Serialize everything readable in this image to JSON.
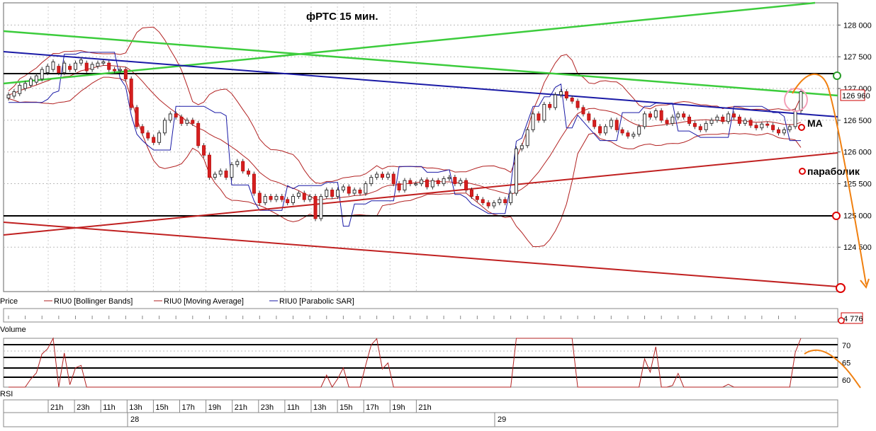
{
  "chart_data": {
    "type": "candlestick",
    "title": "фРТС   15 мин.",
    "price_axis": {
      "ticks": [
        "128 000",
        "127 500",
        "127 000",
        "126 500",
        "126 000",
        "125 500",
        "125 000",
        "124 500"
      ],
      "tick_values": [
        128000,
        127500,
        127000,
        126500,
        126000,
        125500,
        125000,
        124500
      ],
      "ylim": [
        123800,
        128350
      ],
      "current_value_label": "126 960"
    },
    "volume_panel": {
      "label": "Volume",
      "value_label": "4 776"
    },
    "rsi_panel": {
      "label": "RSI",
      "ticks": [
        "70",
        "65",
        "60"
      ],
      "tick_values": [
        70,
        65,
        60
      ],
      "ylim": [
        58,
        72
      ]
    },
    "time_axis": {
      "hour_labels": [
        "21h",
        "23h",
        "11h",
        "13h",
        "15h",
        "17h",
        "19h",
        "21h",
        "23h",
        "11h",
        "13h",
        "15h",
        "17h",
        "19h",
        "21h"
      ],
      "date_labels": [
        "28",
        "29"
      ]
    },
    "legend": [
      "Price",
      "RIU0 [Bollinger Bands]",
      "RIU0 [Moving Average]",
      "RIU0 [Parabolic SAR]"
    ],
    "annotations": [
      "МА",
      "параболик"
    ],
    "candles": [
      [
        126850,
        126900
      ],
      [
        126880,
        126950
      ],
      [
        126920,
        127050
      ],
      [
        127000,
        127080
      ],
      [
        127050,
        127150
      ],
      [
        127100,
        127200
      ],
      [
        127150,
        127300
      ],
      [
        127250,
        127350
      ],
      [
        127300,
        127420
      ],
      [
        127350,
        127250
      ],
      [
        127250,
        127400
      ],
      [
        127350,
        127300
      ],
      [
        127300,
        127400
      ],
      [
        127400,
        127450
      ],
      [
        127400,
        127280
      ],
      [
        127300,
        127380
      ],
      [
        127350,
        127400
      ],
      [
        127400,
        127420
      ],
      [
        127400,
        127300
      ],
      [
        127300,
        127280
      ],
      [
        127290,
        127300
      ],
      [
        127300,
        127150
      ],
      [
        127150,
        126700
      ],
      [
        126700,
        126400
      ],
      [
        126400,
        126300
      ],
      [
        126300,
        126220
      ],
      [
        126230,
        126150
      ],
      [
        126150,
        126300
      ],
      [
        126300,
        126500
      ],
      [
        126500,
        126600
      ],
      [
        126600,
        126550
      ],
      [
        126550,
        126450
      ],
      [
        126450,
        126500
      ],
      [
        126500,
        126450
      ],
      [
        126450,
        126100
      ],
      [
        126100,
        125950
      ],
      [
        125950,
        125600
      ],
      [
        125600,
        125650
      ],
      [
        125650,
        125700
      ],
      [
        125700,
        125600
      ],
      [
        125600,
        125800
      ],
      [
        125800,
        125850
      ],
      [
        125850,
        125700
      ],
      [
        125700,
        125650
      ],
      [
        125650,
        125350
      ],
      [
        125350,
        125200
      ],
      [
        125200,
        125300
      ],
      [
        125300,
        125250
      ],
      [
        125250,
        125300
      ],
      [
        125300,
        125250
      ],
      [
        125250,
        125200
      ],
      [
        125200,
        125300
      ],
      [
        125300,
        125350
      ],
      [
        125350,
        125250
      ],
      [
        125250,
        125300
      ],
      [
        125300,
        124950
      ],
      [
        124950,
        125300
      ],
      [
        125300,
        125400
      ],
      [
        125400,
        125300
      ],
      [
        125300,
        125400
      ],
      [
        125400,
        125450
      ],
      [
        125450,
        125350
      ],
      [
        125350,
        125400
      ],
      [
        125400,
        125350
      ],
      [
        125350,
        125500
      ],
      [
        125500,
        125600
      ],
      [
        125600,
        125650
      ],
      [
        125650,
        125600
      ],
      [
        125600,
        125650
      ],
      [
        125650,
        125500
      ],
      [
        125500,
        125400
      ],
      [
        125400,
        125550
      ],
      [
        125550,
        125500
      ],
      [
        125500,
        125500
      ],
      [
        125500,
        125560
      ],
      [
        125560,
        125450
      ],
      [
        125450,
        125550
      ],
      [
        125550,
        125500
      ],
      [
        125500,
        125580
      ],
      [
        125580,
        125600
      ],
      [
        125600,
        125500
      ],
      [
        125500,
        125550
      ],
      [
        125550,
        125400
      ],
      [
        125400,
        125300
      ],
      [
        125300,
        125250
      ],
      [
        125250,
        125200
      ],
      [
        125200,
        125150
      ],
      [
        125150,
        125200
      ],
      [
        125200,
        125250
      ],
      [
        125250,
        125200
      ],
      [
        125200,
        125350
      ],
      [
        125350,
        126050
      ],
      [
        126050,
        126100
      ],
      [
        126100,
        126350
      ],
      [
        126350,
        126600
      ],
      [
        126600,
        126500
      ],
      [
        126500,
        126750
      ],
      [
        126750,
        126700
      ],
      [
        126700,
        126900
      ],
      [
        126900,
        126950
      ],
      [
        126950,
        126850
      ],
      [
        126850,
        126800
      ],
      [
        126800,
        126700
      ],
      [
        126700,
        126600
      ],
      [
        126600,
        126500
      ],
      [
        126500,
        126400
      ],
      [
        126400,
        126300
      ],
      [
        126300,
        126400
      ],
      [
        126400,
        126500
      ],
      [
        126500,
        126350
      ],
      [
        126350,
        126300
      ],
      [
        126300,
        126250
      ],
      [
        126250,
        126280
      ],
      [
        126280,
        126400
      ],
      [
        126400,
        126600
      ],
      [
        126600,
        126550
      ],
      [
        126550,
        126650
      ],
      [
        126650,
        126500
      ],
      [
        126500,
        126450
      ],
      [
        126450,
        126550
      ],
      [
        126550,
        126600
      ],
      [
        126600,
        126550
      ],
      [
        126550,
        126450
      ],
      [
        126450,
        126400
      ],
      [
        126400,
        126350
      ],
      [
        126350,
        126450
      ],
      [
        126450,
        126500
      ],
      [
        126500,
        126550
      ],
      [
        126550,
        126480
      ],
      [
        126480,
        126600
      ],
      [
        126600,
        126550
      ],
      [
        126550,
        126450
      ],
      [
        126450,
        126500
      ],
      [
        126500,
        126420
      ],
      [
        126420,
        126380
      ],
      [
        126380,
        126440
      ],
      [
        126440,
        126420
      ],
      [
        126420,
        126350
      ],
      [
        126350,
        126300
      ],
      [
        126300,
        126350
      ],
      [
        126350,
        126400
      ],
      [
        126400,
        126650
      ],
      [
        126650,
        126950
      ]
    ]
  }
}
